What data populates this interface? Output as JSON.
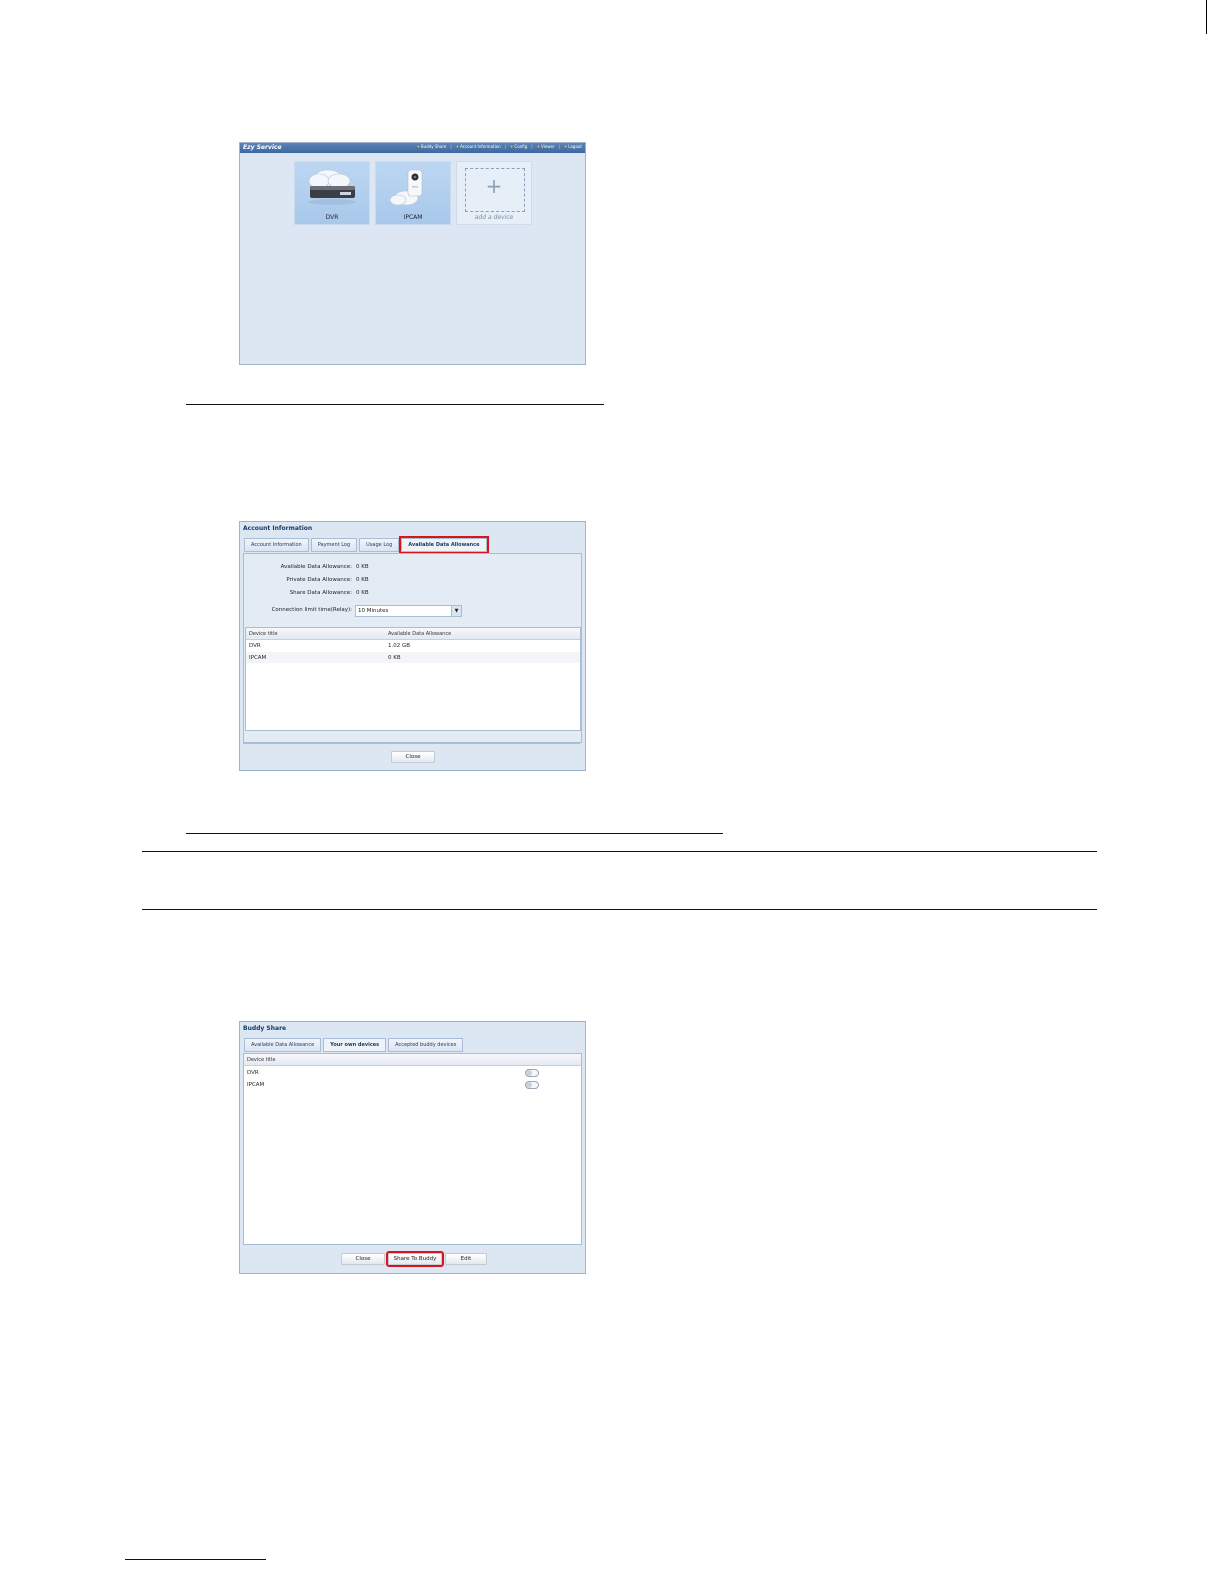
{
  "ezy_service": {
    "title": "Ezy Service",
    "nav": [
      "Buddy Share",
      "Account Information",
      "Config",
      "Viewer",
      "Logout"
    ],
    "tiles": [
      "DVR",
      "IPCAM",
      "add a device"
    ]
  },
  "account_info": {
    "title": "Account Information",
    "tabs": [
      "Account Information",
      "Payment Log",
      "Usage Log",
      "Available Data Allowance"
    ],
    "fields": [
      {
        "label": "Available Data Allowance:",
        "value": "0 KB"
      },
      {
        "label": "Private Data Allowance:",
        "value": "0 KB"
      },
      {
        "label": "Share Data Allowance:",
        "value": "0 KB"
      }
    ],
    "connection_limit_label": "Connection limit time(Relay):",
    "connection_limit_value": "10 Minutes",
    "columns": [
      "Device title",
      "Available Data Allowance"
    ],
    "rows": [
      {
        "device": "DVR",
        "allowance": "1.02 GB"
      },
      {
        "device": "IPCAM",
        "allowance": "0 KB"
      }
    ],
    "close_label": "Close"
  },
  "buddy_share": {
    "title": "Buddy Share",
    "tabs": [
      "Available Data Allowance",
      "Your own devices",
      "Accepted buddy devices"
    ],
    "column": "Device title",
    "rows": [
      "DVR",
      "IPCAM"
    ],
    "buttons": {
      "close": "Close",
      "share": "Share To Buddy",
      "edit": "Edit"
    }
  }
}
